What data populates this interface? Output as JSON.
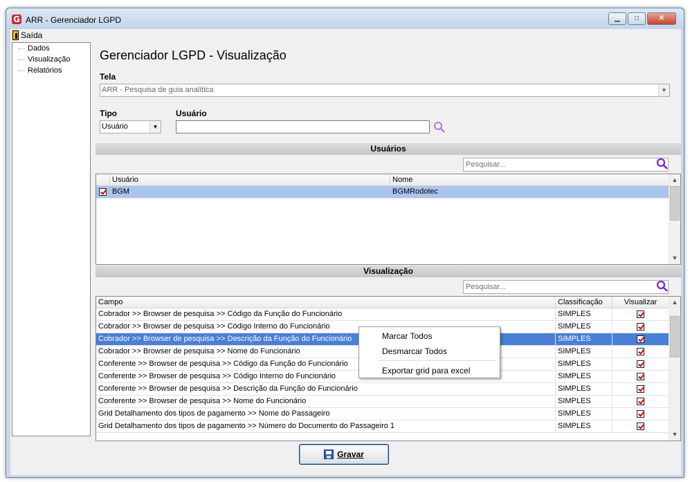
{
  "window": {
    "title": "ARR - Gerenciador LGPD",
    "app_icon_letter": "G"
  },
  "menu": {
    "exit_label": "Saída"
  },
  "tree": {
    "items": [
      "Dados",
      "Visualização",
      "Relatórios"
    ]
  },
  "page": {
    "title": "Gerenciador LGPD - Visualização"
  },
  "tela": {
    "label": "Tela",
    "value": "ARR - Pesquisa de guia analítica"
  },
  "tipo": {
    "label": "Tipo",
    "value": "Usuário"
  },
  "usuario": {
    "label": "Usuário",
    "value": ""
  },
  "usuarios_section": {
    "title": "Usuários",
    "search_placeholder": "Pesquisar...",
    "columns": [
      "Usuário",
      "Nome"
    ],
    "rows": [
      {
        "checked": true,
        "usuario": "BGM",
        "nome": "BGMRodotec"
      }
    ]
  },
  "visualizacao_section": {
    "title": "Visualização",
    "search_placeholder": "Pesquisar...",
    "columns": [
      "Campo",
      "Classificação",
      "Visualizar"
    ],
    "rows": [
      {
        "campo": "Cobrador >> Browser de pesquisa >> Código da Função do Funcionário",
        "classificacao": "SIMPLES",
        "visualizar": true
      },
      {
        "campo": "Cobrador >> Browser de pesquisa >> Código Interno do Funcionário",
        "classificacao": "SIMPLES",
        "visualizar": true
      },
      {
        "campo": "Cobrador >> Browser de pesquisa >> Descrição da Função do Funcionário",
        "classificacao": "SIMPLES",
        "visualizar": true
      },
      {
        "campo": "Cobrador >> Browser de pesquisa >> Nome do Funcionário",
        "classificacao": "SIMPLES",
        "visualizar": true
      },
      {
        "campo": "Conferente >> Browser de pesquisa >> Código da Função do Funcionário",
        "classificacao": "SIMPLES",
        "visualizar": true
      },
      {
        "campo": "Conferente >> Browser de pesquisa >> Código Interno do Funcionário",
        "classificacao": "SIMPLES",
        "visualizar": true
      },
      {
        "campo": "Conferente >> Browser de pesquisa >> Descrição da Função do Funcionário",
        "classificacao": "SIMPLES",
        "visualizar": true
      },
      {
        "campo": "Conferente >> Browser de pesquisa >> Nome do Funcionário",
        "classificacao": "SIMPLES",
        "visualizar": true
      },
      {
        "campo": "Grid Detalhamento dos tipos de pagamento >> Nome do Passageiro",
        "classificacao": "SIMPLES",
        "visualizar": true
      },
      {
        "campo": "Grid Detalhamento dos tipos de pagamento >> Número do Documento do Passageiro 1",
        "classificacao": "SIMPLES",
        "visualizar": true
      }
    ]
  },
  "context_menu": {
    "items": [
      "Marcar Todos",
      "Desmarcar Todos",
      "Exportar grid para excel"
    ]
  },
  "buttons": {
    "gravar": "Gravar"
  },
  "colors": {
    "selection": "#4a7fd6",
    "check": "#d00000",
    "search_icon": "#8a2be2"
  }
}
